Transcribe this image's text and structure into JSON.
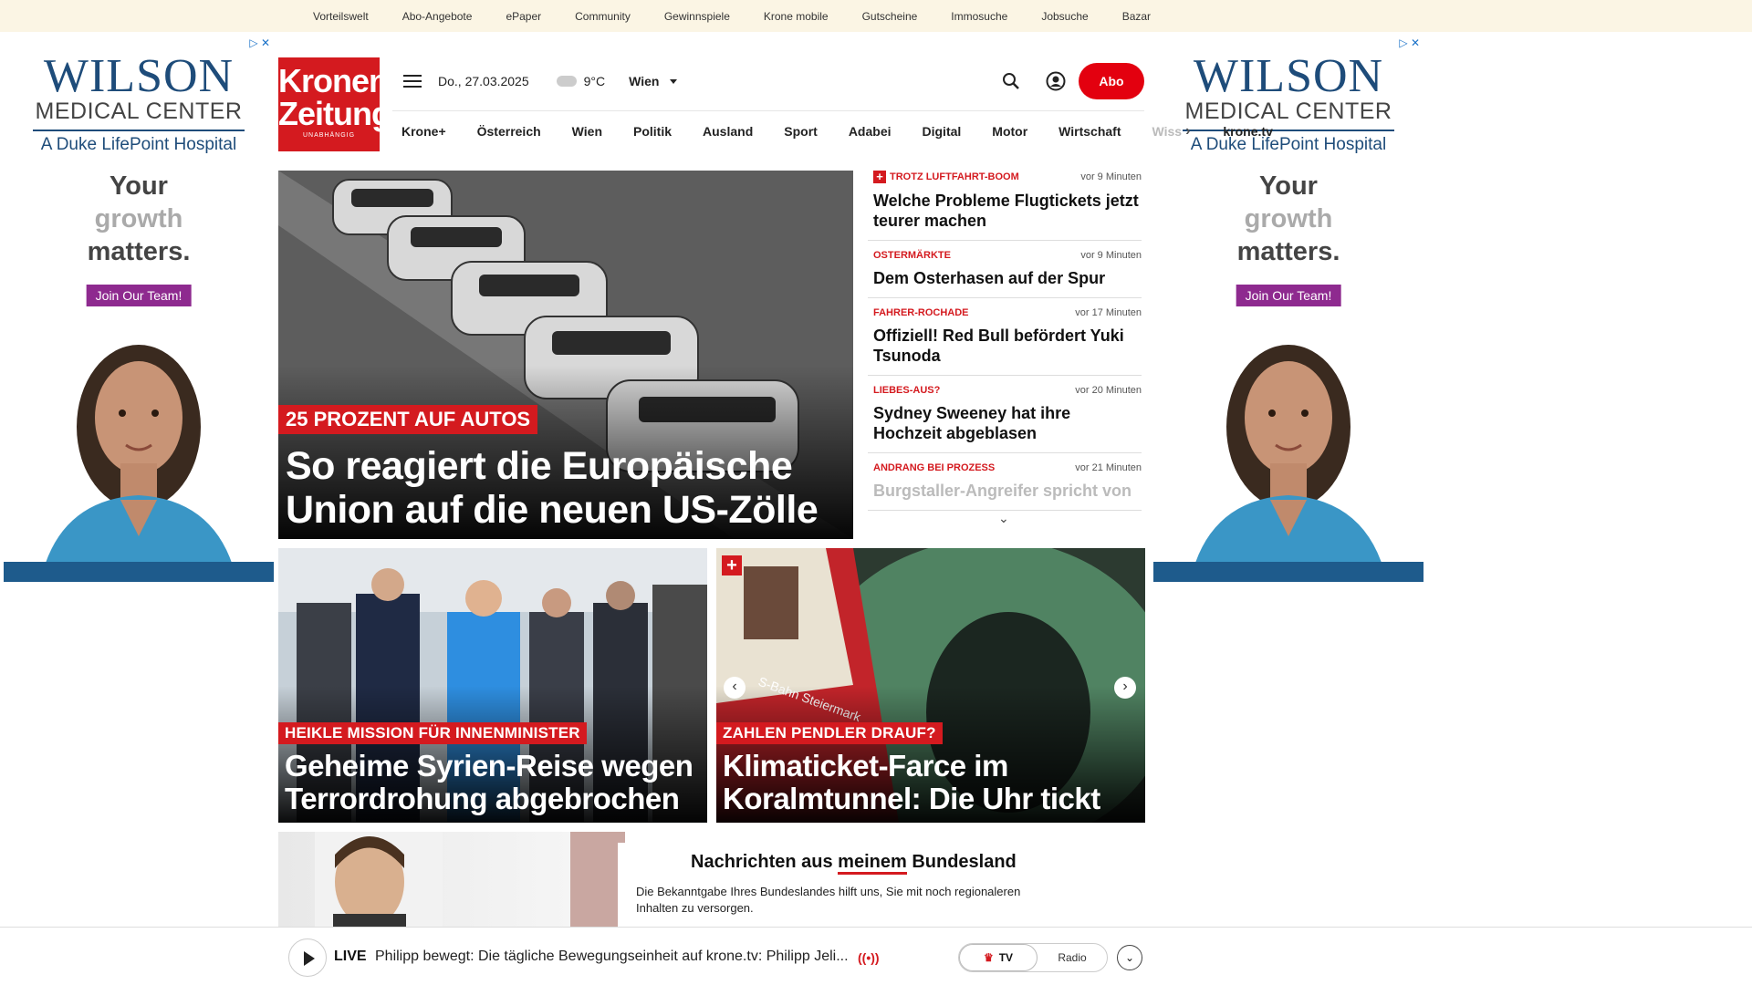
{
  "top_links": [
    "Vorteilswelt",
    "Abo-Angebote",
    "ePaper",
    "Community",
    "Gewinnspiele",
    "Krone mobile",
    "Gutscheine",
    "Immosuche",
    "Jobsuche",
    "Bazar"
  ],
  "ad": {
    "brand_line1": "WILSON",
    "brand_line2": "MEDICAL CENTER",
    "brand_line3": "A Duke LifePoint Hospital",
    "slogan_1": "Your",
    "slogan_2": "growth",
    "slogan_3": "matters.",
    "cta": "Join Our Team!",
    "adchoice": "▷ ✕"
  },
  "logo": {
    "line1": "Kronen",
    "line2": "Zeitung",
    "line3": "UNABHÄNGIG"
  },
  "header": {
    "date": "Do., 27.03.2025",
    "temp": "9°C",
    "city": "Wien",
    "abo_label": "Abo"
  },
  "nav": [
    "Krone+",
    "Österreich",
    "Wien",
    "Politik",
    "Ausland",
    "Sport",
    "Adabei",
    "Digital",
    "Motor",
    "Wirtschaft"
  ],
  "nav_fade": "Wiss",
  "nav_tv": "krone.tv",
  "hero": {
    "tag": "25 PROZENT AUF AUTOS",
    "title_line1": "So reagiert die Europäische",
    "title_line2": "Union auf die neuen US-Zölle"
  },
  "ticker": [
    {
      "kicker": "TROTZ LUFTFAHRT-BOOM",
      "time": "vor 9 Minuten",
      "title": "Welche Probleme Flugtickets jetzt teurer machen",
      "plus": true
    },
    {
      "kicker": "OSTERMÄRKTE",
      "time": "vor 9 Minuten",
      "title": "Dem Osterhasen auf der Spur",
      "plus": false
    },
    {
      "kicker": "FAHRER-ROCHADE",
      "time": "vor 17 Minuten",
      "title": "Offiziell! Red Bull befördert Yuki Tsunoda",
      "plus": false
    },
    {
      "kicker": "LIEBES-AUS?",
      "time": "vor 20 Minuten",
      "title": "Sydney Sweeney hat ihre Hochzeit abgeblasen",
      "plus": false
    },
    {
      "kicker": "ANDRANG BEI PROZESS",
      "time": "vor 21 Minuten",
      "title": "Burgstaller-Angreifer spricht von",
      "plus": false
    }
  ],
  "cards": [
    {
      "tag": "HEIKLE MISSION FÜR INNENMINISTER",
      "title_line1": "Geheime Syrien-Reise wegen",
      "title_line2": "Terrordrohung abgebrochen"
    },
    {
      "tag": "ZAHLEN PENDLER DRAUF?",
      "title_line1": "Klimaticket-Farce im",
      "title_line2": "Koralmtunnel: Die Uhr tickt",
      "train_text": "S-Bahn Steiermark"
    }
  ],
  "bundesland": {
    "heading_pre": "Nachrichten aus ",
    "heading_hl": "meinem",
    "heading_post": " Bundesland",
    "text": "Die Bekanntgabe Ihres Bundeslandes hilft uns, Sie mit noch regionaleren Inhalten zu versorgen."
  },
  "player": {
    "live": "LIVE",
    "title": "Philipp bewegt: Die tägliche Bewegungseinheit auf krone.tv: Philipp Jeli...",
    "tv": "TV",
    "radio": "Radio"
  },
  "colors": {
    "brand_red": "#d41a1f",
    "abo_red": "#e3000f",
    "topbar_bg": "#fbf5e4",
    "ad_blue": "#1e4c7a"
  }
}
